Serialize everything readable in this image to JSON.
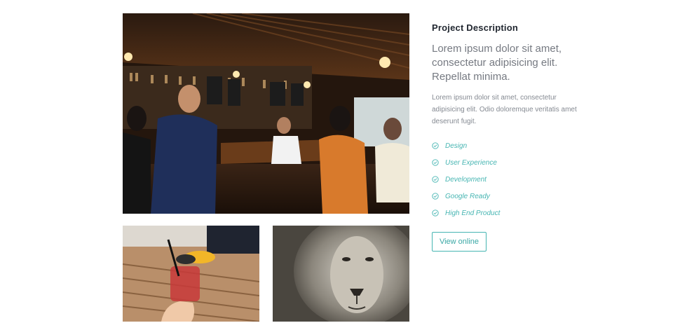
{
  "project": {
    "heading": "Project Description",
    "lead": "Lorem ipsum dolor sit amet, consectetur adipisicing elit. Repellat minima.",
    "body": "Lorem ipsum dolor sit amet, consectetur adipisicing elit. Odio doloremque veritatis amet deserunt fugit.",
    "features": [
      {
        "label": "Design",
        "icon": "check-circle-icon"
      },
      {
        "label": "User Experience",
        "icon": "check-circle-icon"
      },
      {
        "label": "Development",
        "icon": "check-circle-icon"
      },
      {
        "label": "Google Ready",
        "icon": "check-circle-icon"
      },
      {
        "label": "High End Product",
        "icon": "check-circle-icon"
      }
    ],
    "view_button": "View online"
  },
  "colors": {
    "accent": "#46b5b2",
    "heading": "#222831",
    "text_muted": "#858a92"
  },
  "gallery": [
    {
      "subject": "busy bar interior photo"
    },
    {
      "subject": "cocktail glass on wooden table photo"
    },
    {
      "subject": "lion face black and white photo"
    }
  ]
}
